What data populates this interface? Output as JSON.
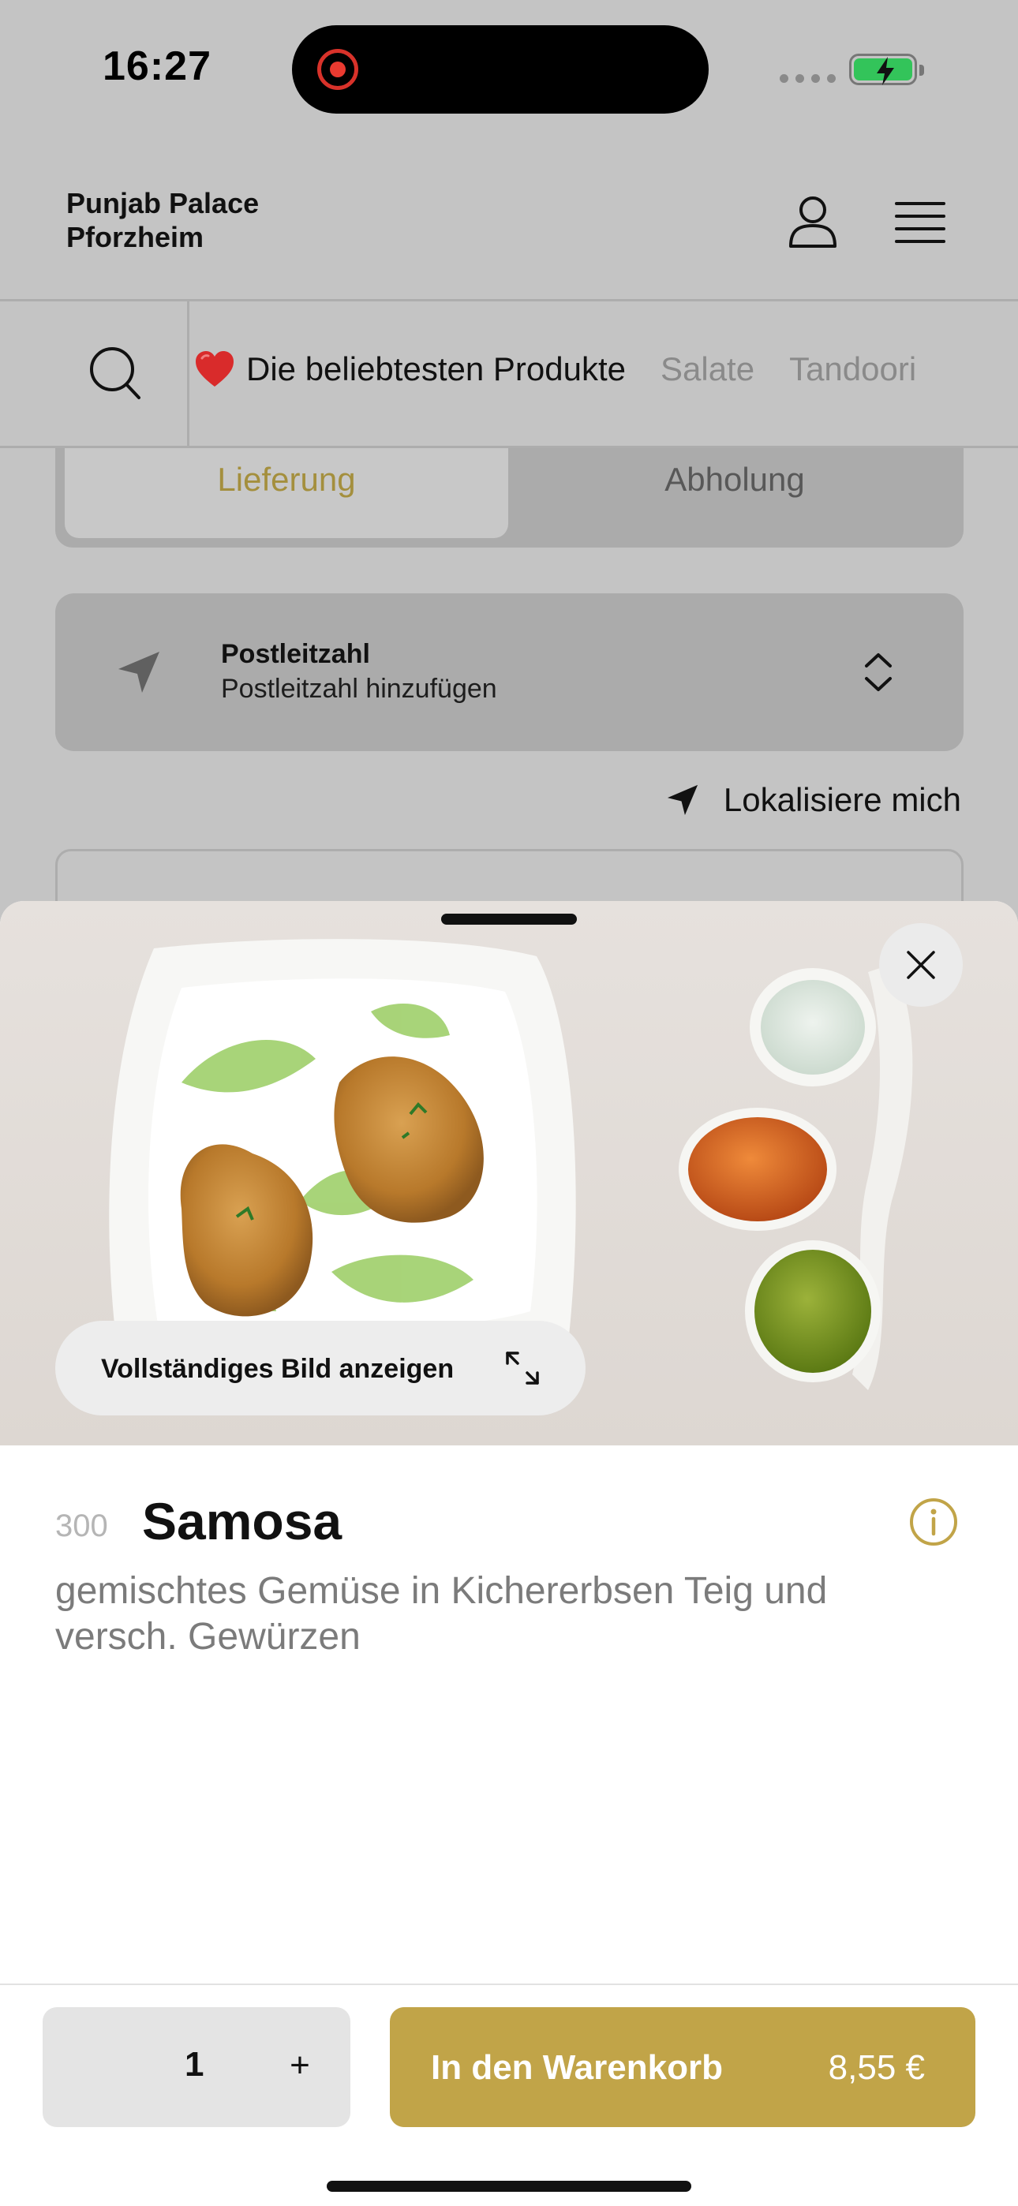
{
  "status_bar": {
    "time": "16:27"
  },
  "header": {
    "brand_line1": "Punjab Palace",
    "brand_line2": "Pforzheim"
  },
  "categories": {
    "items": [
      "Die beliebtesten Produkte",
      "Salate",
      "Tandoori"
    ],
    "active_emoji": "❤️"
  },
  "order_type": {
    "delivery": "Lieferung",
    "pickup": "Abholung",
    "selected": "Lieferung"
  },
  "postal_code": {
    "title": "Postleitzahl",
    "subtitle": "Postleitzahl hinzufügen"
  },
  "locate": {
    "label": "Lokalisiere mich"
  },
  "product": {
    "full_image_label": "Vollständiges Bild anzeigen",
    "number": "300",
    "name": "Samosa",
    "description": "gemischtes Gemüse in Kichererbsen Teig und versch. Gewürzen"
  },
  "footer": {
    "quantity": "1",
    "plus": "+",
    "add_to_cart": "In den Warenkorb",
    "price": "8,55 €"
  },
  "colors": {
    "accent": "#c1a448",
    "overlay": "#c4c4c4",
    "heart": "#d92b2b"
  },
  "icons": [
    "user-icon",
    "menu-icon",
    "search-icon",
    "navigation-arrow-icon",
    "chevron-up-down-icon",
    "close-icon",
    "expand-icon",
    "info-icon"
  ]
}
